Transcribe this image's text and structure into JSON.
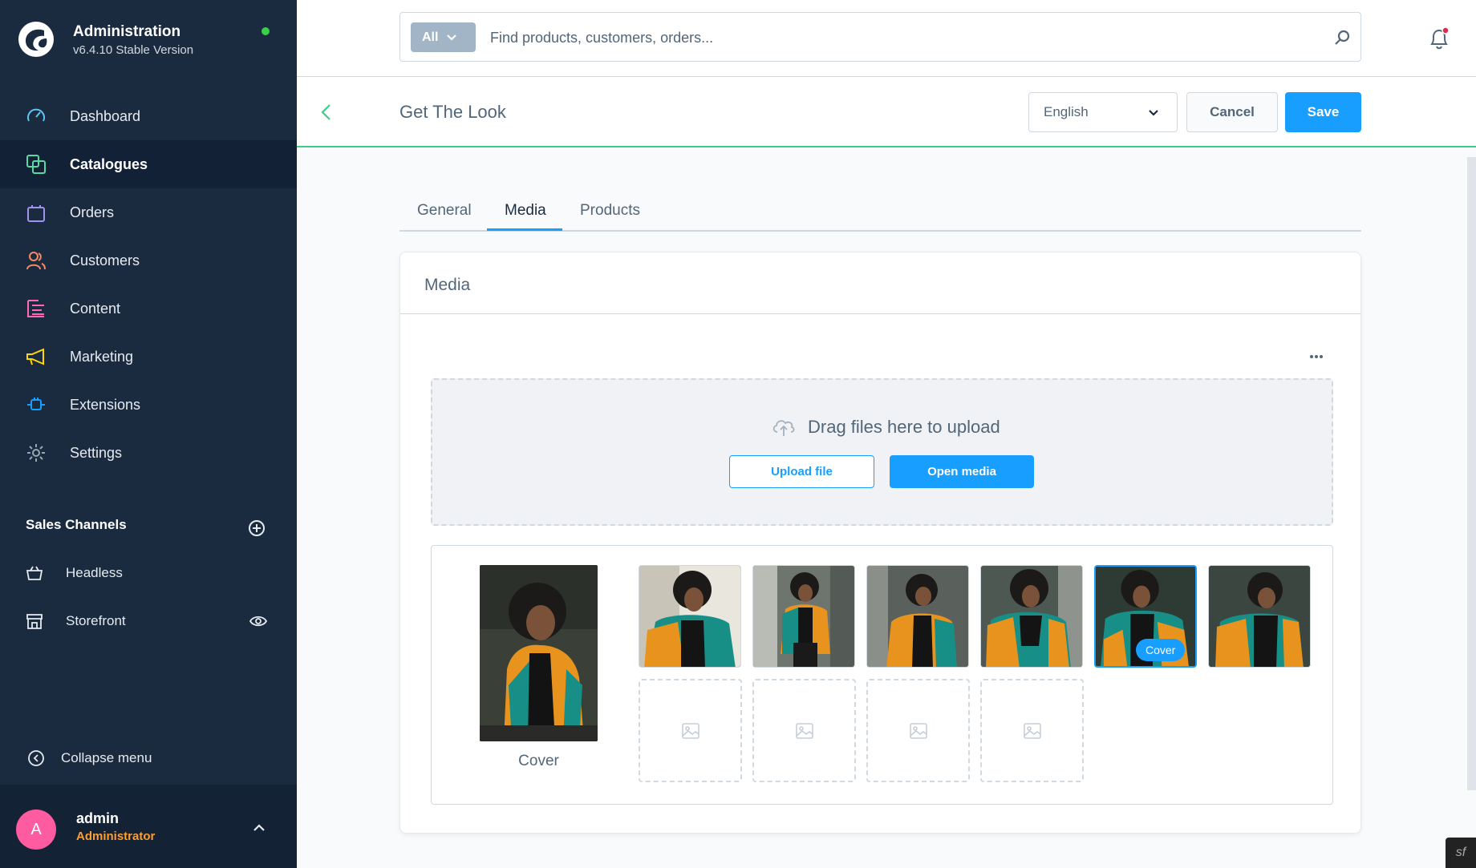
{
  "brand": {
    "title": "Administration",
    "version": "v6.4.10 Stable Version",
    "status_color": "#37d046"
  },
  "nav": {
    "items": [
      {
        "label": "Dashboard",
        "icon": "gauge-icon",
        "color": "#5ec6f5"
      },
      {
        "label": "Catalogues",
        "icon": "catalogue-icon",
        "color": "#57d9a3"
      },
      {
        "label": "Orders",
        "icon": "shopping-bag-icon",
        "color": "#a092f0"
      },
      {
        "label": "Customers",
        "icon": "users-icon",
        "color": "#f88962"
      },
      {
        "label": "Content",
        "icon": "content-icon",
        "color": "#ff68b4"
      },
      {
        "label": "Marketing",
        "icon": "megaphone-icon",
        "color": "#ffd700"
      },
      {
        "label": "Extensions",
        "icon": "plug-icon",
        "color": "#189eff"
      },
      {
        "label": "Settings",
        "icon": "gear-icon",
        "color": "#9aa8b5"
      }
    ],
    "active_index": 1
  },
  "sales_channels": {
    "heading": "Sales Channels",
    "items": [
      {
        "label": "Headless",
        "icon": "basket-icon"
      },
      {
        "label": "Storefront",
        "icon": "storefront-icon"
      }
    ]
  },
  "collapse_label": "Collapse menu",
  "user": {
    "initial": "A",
    "name": "admin",
    "role": "Administrator"
  },
  "search": {
    "type_label": "All",
    "placeholder": "Find products, customers, orders..."
  },
  "page": {
    "title": "Get The Look",
    "language": "English",
    "cancel_label": "Cancel",
    "save_label": "Save"
  },
  "tabs": [
    {
      "label": "General"
    },
    {
      "label": "Media"
    },
    {
      "label": "Products"
    }
  ],
  "active_tab": "Media",
  "media": {
    "card_title": "Media",
    "dropzone_text": "Drag files here to upload",
    "upload_label": "Upload file",
    "open_media_label": "Open media",
    "cover_label": "Cover",
    "thumbnails": [
      {
        "selected": false
      },
      {
        "selected": false
      },
      {
        "selected": false
      },
      {
        "selected": false
      },
      {
        "selected": true,
        "badge": "Cover"
      },
      {
        "selected": false
      }
    ],
    "empty_slots": 4
  },
  "colors": {
    "accent": "#189eff",
    "sidebar_bg": "#1a2a3f",
    "header_border": "#3dcc8a"
  }
}
